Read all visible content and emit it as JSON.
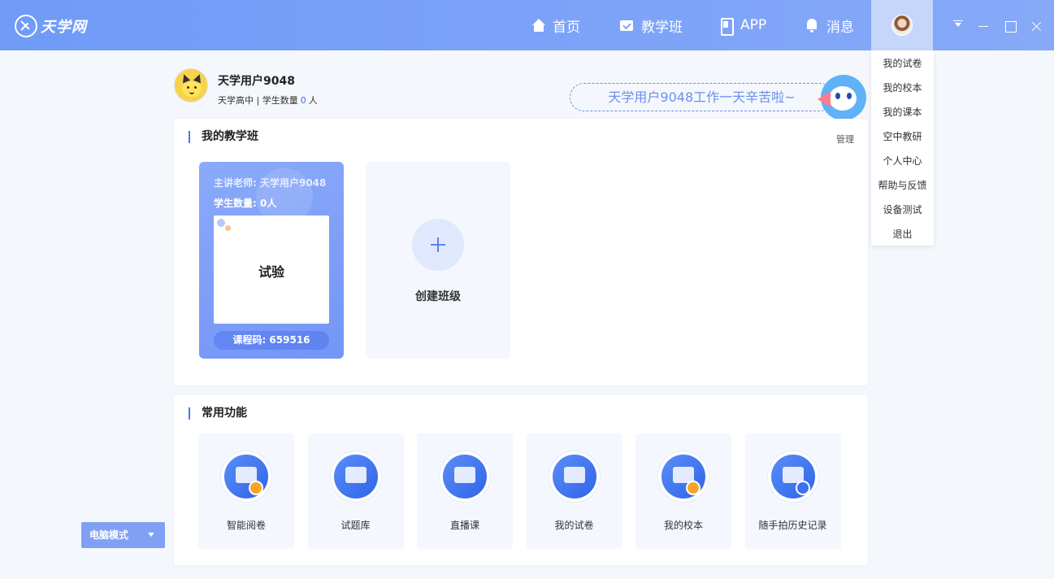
{
  "app": {
    "logo_text": "天学网",
    "brand_color": "#7ba3f7"
  },
  "nav": {
    "home": "首页",
    "class": "教学班",
    "app": "APP",
    "messages": "消息"
  },
  "user_menu": {
    "items": [
      "我的试卷",
      "我的校本",
      "我的课本",
      "空中教研",
      "个人中心",
      "帮助与反馈",
      "设备测试",
      "退出"
    ]
  },
  "profile": {
    "name": "天学用户9048",
    "school": "天学高中",
    "separator": " | ",
    "students_label": "学生数量",
    "students_count": "0",
    "students_unit": "人",
    "banner": "天学用户9048工作一天辛苦啦~"
  },
  "classes": {
    "section_title": "我的教学班",
    "manage_label": "管理",
    "items": [
      {
        "teacher": "主讲老师: 天学用户9048",
        "students": "学生数量: 0人",
        "name": "试验",
        "code": "课程码: 659516"
      }
    ],
    "create_label": "创建班级"
  },
  "functions": {
    "section_title": "常用功能",
    "items": [
      {
        "label": "智能阅卷",
        "icon": "paper-grading-icon"
      },
      {
        "label": "试题库",
        "icon": "question-bank-icon"
      },
      {
        "label": "直播课",
        "icon": "live-class-icon"
      },
      {
        "label": "我的试卷",
        "icon": "my-papers-icon"
      },
      {
        "label": "我的校本",
        "icon": "school-book-icon"
      },
      {
        "label": "随手拍历史记录",
        "icon": "photo-history-icon"
      }
    ]
  },
  "mode": {
    "label": "电脑模式"
  }
}
